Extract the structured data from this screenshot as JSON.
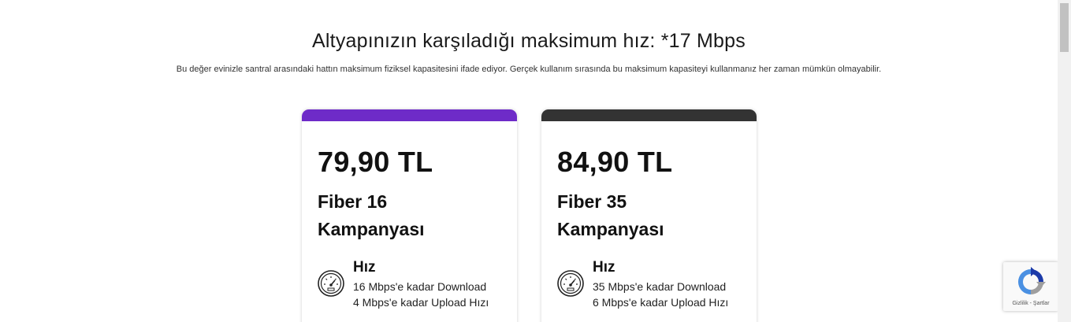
{
  "header": {
    "title": "Altyapınızın karşıladığı maksimum hız: *17 Mbps",
    "subtitle": "Bu değer evinizle santral arasındaki hattın maksimum fiziksel kapasitesini ifade ediyor. Gerçek kullanım sırasında bu maksimum kapasiteyi kullanmanız her zaman mümkün olmayabilir."
  },
  "plans": [
    {
      "price": "79,90 TL",
      "name": "Fiber 16 Kampanyası",
      "accent_color": "#6e2bc8",
      "speed_title": "Hız",
      "download": "16 Mbps'e kadar Download",
      "upload": "4 Mbps'e kadar Upload Hızı",
      "icon": "speedometer-icon"
    },
    {
      "price": "84,90 TL",
      "name": "Fiber 35 Kampanyası",
      "accent_color": "#333333",
      "speed_title": "Hız",
      "download": "35 Mbps'e kadar Download",
      "upload": "6 Mbps'e kadar Upload Hızı",
      "icon": "speedometer-icon"
    }
  ],
  "recaptcha": {
    "terms": "Gizlilik - Şartlar",
    "icon": "recaptcha-icon"
  },
  "scrollbar": {
    "icon": "scroll-up-arrow-icon"
  }
}
